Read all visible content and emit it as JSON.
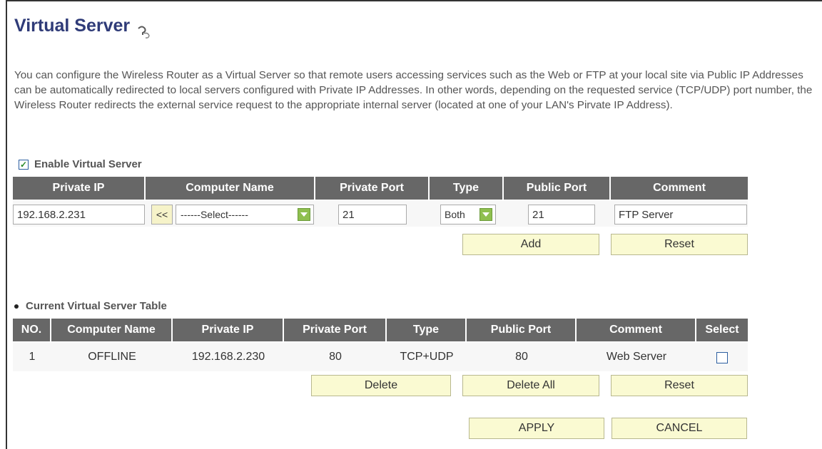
{
  "page": {
    "title": "Virtual Server",
    "description": "You can configure the Wireless Router as a Virtual Server so that remote users accessing services such as the Web or FTP at your local site via Public IP Addresses can be automatically redirected to local servers configured with Private IP Addresses. In other words, depending on the requested service (TCP/UDP) port number, the Wireless Router redirects the external service request to the appropriate internal server (located at one of your LAN's Pirvate IP Address)."
  },
  "enable": {
    "label": "Enable Virtual Server",
    "checked": true
  },
  "entry": {
    "headers": [
      "Private IP",
      "Computer Name",
      "Private Port",
      "Type",
      "Public Port",
      "Comment"
    ],
    "private_ip": "192.168.2.231",
    "copy_button": "<<",
    "computer_name_select": "------Select------",
    "private_port": "21",
    "type_select": "Both",
    "public_port": "21",
    "comment": "FTP Server",
    "add_label": "Add",
    "reset_label": "Reset"
  },
  "table": {
    "section_title": "Current Virtual Server Table",
    "headers": [
      "NO.",
      "Computer Name",
      "Private IP",
      "Private Port",
      "Type",
      "Public Port",
      "Comment",
      "Select"
    ],
    "rows": [
      {
        "no": "1",
        "computer_name": "OFFLINE",
        "private_ip": "192.168.2.230",
        "private_port": "80",
        "type": "TCP+UDP",
        "public_port": "80",
        "comment": "Web Server",
        "selected": false
      }
    ],
    "delete_label": "Delete",
    "delete_all_label": "Delete All",
    "reset_label": "Reset"
  },
  "footer": {
    "apply_label": "APPLY",
    "cancel_label": "CANCEL"
  },
  "icons": {
    "help": "help-question-icon",
    "select_arrow": "chevron-down-icon"
  },
  "colors": {
    "title": "#2f3b78",
    "header_bg": "#676767",
    "button_bg": "#fafad2",
    "select_arrow": "#8fbf4f"
  }
}
